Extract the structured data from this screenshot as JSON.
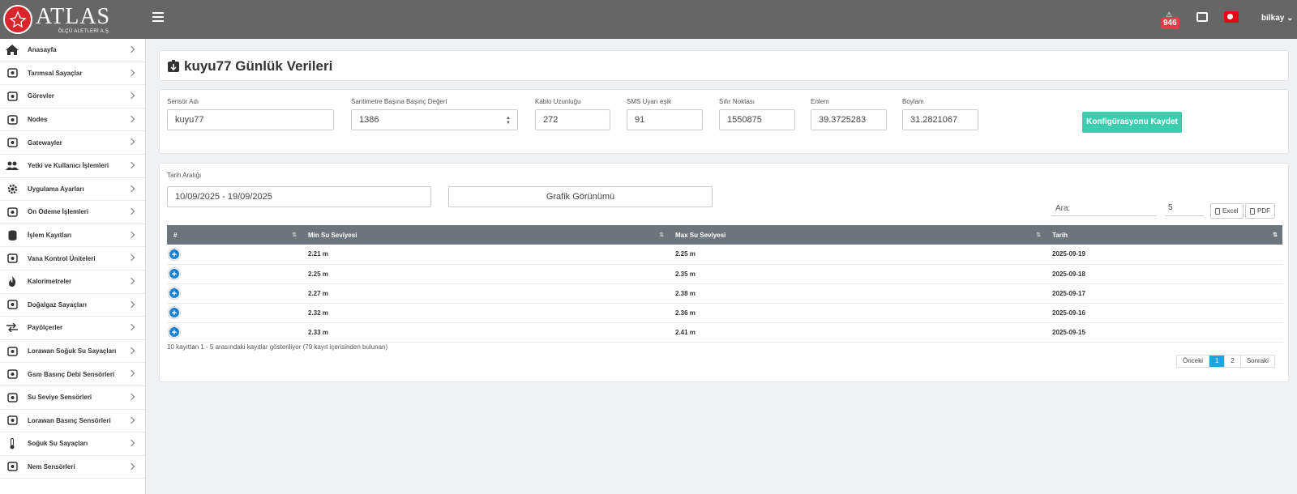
{
  "brand": {
    "name": "ATLAS",
    "tagline": "ÖLÇÜ ALETLERİ A.Ş."
  },
  "header": {
    "notification_count": "946",
    "user": "bilkay"
  },
  "sidebar": {
    "items": [
      {
        "label": "Anasayfa",
        "icon": "home-icon"
      },
      {
        "label": "Tarımsal Sayaçlar",
        "icon": "wheat-icon"
      },
      {
        "label": "Görevler",
        "icon": "task-icon"
      },
      {
        "label": "Nodes",
        "icon": "router-icon"
      },
      {
        "label": "Gatewayler",
        "icon": "antenna-icon"
      },
      {
        "label": "Yetki ve Kullanıcı İşlemleri",
        "icon": "users-icon"
      },
      {
        "label": "Uygulama Ayarları",
        "icon": "gear-icon"
      },
      {
        "label": "Ön Ödeme İşlemleri",
        "icon": "card-icon"
      },
      {
        "label": "İşlem Kayıtları",
        "icon": "database-icon"
      },
      {
        "label": "Vana Kontrol Üniteleri",
        "icon": "valve-icon"
      },
      {
        "label": "Kalorimetreler",
        "icon": "flame-icon"
      },
      {
        "label": "Doğalgaz Sayaçları",
        "icon": "gas-icon"
      },
      {
        "label": "Payölçerler",
        "icon": "exchange-icon"
      },
      {
        "label": "Lorawan Soğuk Su Sayaçları",
        "icon": "gauge-icon"
      },
      {
        "label": "Gsm Basınç Debi Sensörleri",
        "icon": "sensor-icon"
      },
      {
        "label": "Su Seviye Sensörleri",
        "icon": "water-level-icon"
      },
      {
        "label": "Lorawan Basınç Sensörleri",
        "icon": "pressure-icon"
      },
      {
        "label": "Soğuk Su Sayaçları",
        "icon": "thermometer-icon"
      },
      {
        "label": "Nem Sensörleri",
        "icon": "humidity-icon"
      }
    ]
  },
  "page": {
    "title": "kuyu77 Günlük Verileri"
  },
  "config": {
    "sensor_name": {
      "label": "Sensör Adı",
      "value": "kuyu77"
    },
    "pressure_per_cm": {
      "label": "Santimetre Başına Başınç Değeri",
      "value": "1386"
    },
    "cable_length": {
      "label": "Kablo Uzunluğu",
      "value": "272"
    },
    "sms_threshold": {
      "label": "SMS Uyarı eşik",
      "value": "91"
    },
    "zero_point": {
      "label": "Sıfır Noktası",
      "value": "1550875"
    },
    "latitude": {
      "label": "Enlem",
      "value": "39.3725283"
    },
    "longitude": {
      "label": "Boylam",
      "value": "31.2821067"
    },
    "save_label": "Konfigürasyonu Kaydet"
  },
  "filters": {
    "date_label": "Tarih Aralığı",
    "date_range": "10/09/2025 - 19/09/2025",
    "graph_label": "Grafik Görünümü",
    "search_label": "Ara:",
    "page_length": "5",
    "excel_label": "Excel",
    "pdf_label": "PDF"
  },
  "table": {
    "columns": [
      "#",
      "Min Su Seviyesi",
      "Max Su Seviyesi",
      "Tarih"
    ],
    "rows": [
      {
        "min": "2.21 m",
        "max": "2.25 m",
        "date": "2025-09-19"
      },
      {
        "min": "2.25 m",
        "max": "2.35 m",
        "date": "2025-09-18"
      },
      {
        "min": "2.27 m",
        "max": "2.38 m",
        "date": "2025-09-17"
      },
      {
        "min": "2.32 m",
        "max": "2.36 m",
        "date": "2025-09-16"
      },
      {
        "min": "2.33 m",
        "max": "2.41 m",
        "date": "2025-09-15"
      }
    ],
    "info": "10 kayıttan 1 - 5 arasındaki kayıtlar gösteriliyor (79 kayıt içerisinden bulunan)"
  },
  "pagination": {
    "prev": "Önceki",
    "pages": [
      "1",
      "2"
    ],
    "current": "1",
    "next": "Sonraki"
  },
  "colors": {
    "topbar": "#666666",
    "accent": "#3ccdaf",
    "table_header": "#6c757d",
    "badge": "#e63b4b",
    "active_page": "#1ea4de"
  }
}
